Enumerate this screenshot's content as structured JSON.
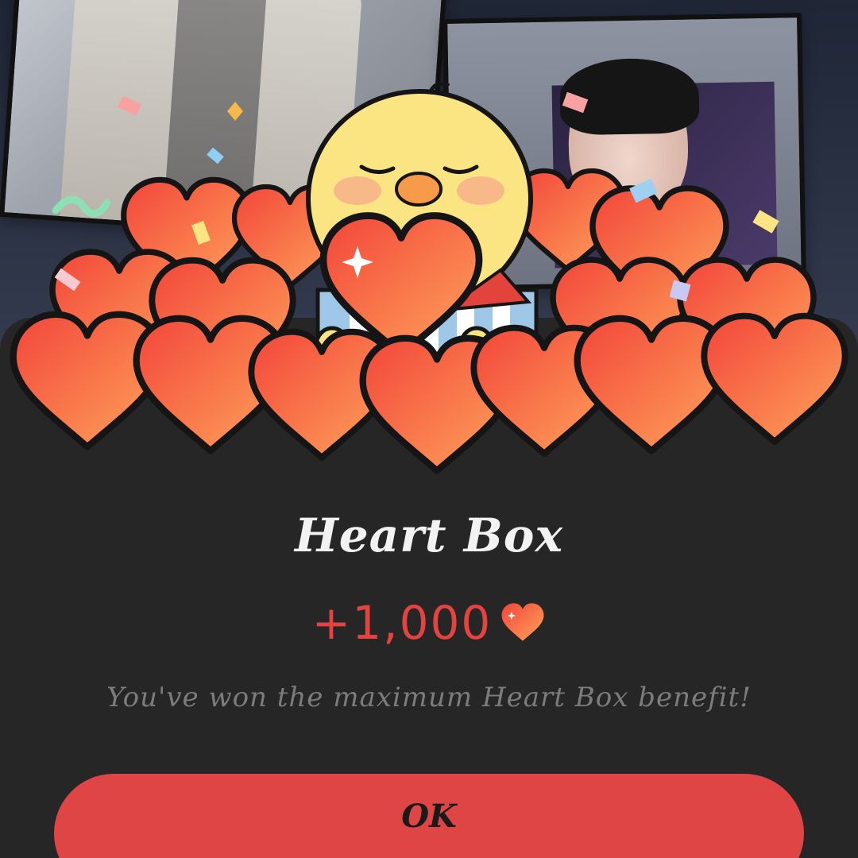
{
  "dialog": {
    "title": "Heart Box",
    "amount": "+1,000",
    "message": "You've won the maximum Heart Box benefit!",
    "ok_label": "OK",
    "amount_icon": "heart-icon"
  },
  "colors": {
    "accent": "#e04546",
    "amount_text": "#e5433f",
    "sheet_background": "#262626",
    "title_text": "#f2f2f2",
    "message_text": "#7c7c7c"
  }
}
